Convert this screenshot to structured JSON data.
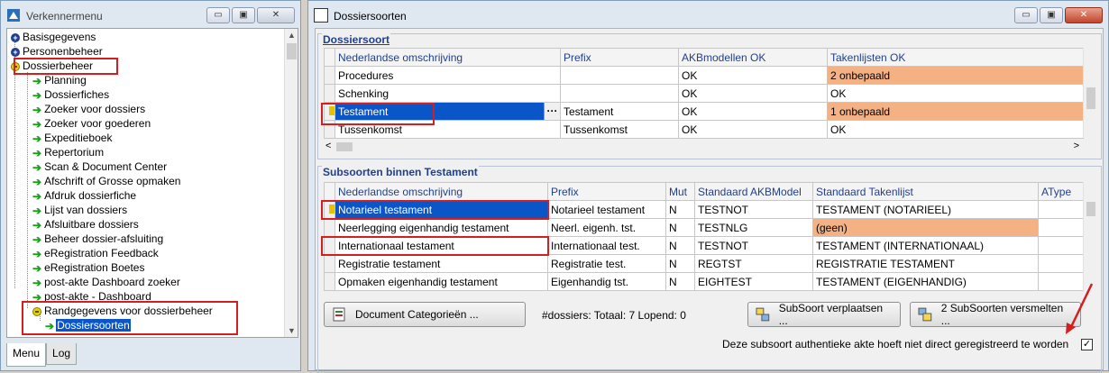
{
  "left_window": {
    "title": "Verkennermenu",
    "min": "▭",
    "max": "▣",
    "close": "✕",
    "tree": [
      {
        "label": "Basisgegevens",
        "type": "plus",
        "level": 0
      },
      {
        "label": "Personenbeheer",
        "type": "plus",
        "level": 0
      },
      {
        "label": "Dossierbeheer",
        "type": "minus",
        "level": 0
      },
      {
        "label": "Planning",
        "type": "leaf",
        "level": 1
      },
      {
        "label": "Dossierfiches",
        "type": "leaf",
        "level": 1
      },
      {
        "label": "Zoeker voor dossiers",
        "type": "leaf",
        "level": 1
      },
      {
        "label": "Zoeker voor goederen",
        "type": "leaf",
        "level": 1
      },
      {
        "label": "Expeditieboek",
        "type": "leaf",
        "level": 1
      },
      {
        "label": "Repertorium",
        "type": "leaf",
        "level": 1
      },
      {
        "label": "Scan & Document Center",
        "type": "leaf",
        "level": 1
      },
      {
        "label": "Afschrift of Grosse opmaken",
        "type": "leaf",
        "level": 1
      },
      {
        "label": "Afdruk dossierfiche",
        "type": "leaf",
        "level": 1
      },
      {
        "label": "Lijst van dossiers",
        "type": "leaf",
        "level": 1
      },
      {
        "label": "Afsluitbare dossiers",
        "type": "leaf",
        "level": 1
      },
      {
        "label": "Beheer dossier-afsluiting",
        "type": "leaf",
        "level": 1
      },
      {
        "label": "eRegistration Feedback",
        "type": "leaf",
        "level": 1
      },
      {
        "label": "eRegistration Boetes",
        "type": "leaf",
        "level": 1
      },
      {
        "label": "post-akte Dashboard zoeker",
        "type": "leaf",
        "level": 1
      },
      {
        "label": "post-akte - Dashboard",
        "type": "leaf",
        "level": 1
      },
      {
        "label": "Randgegevens voor dossierbeheer",
        "type": "minus",
        "level": 1
      },
      {
        "label": "Dossiersoorten",
        "type": "leaf",
        "level": 2,
        "selected": true
      }
    ],
    "tabs": [
      "Menu",
      "Log"
    ]
  },
  "right_window": {
    "title": "Dossiersoorten",
    "min": "▭",
    "max": "▣",
    "close": "✕",
    "dossiersoort": {
      "group_title": "Dossiersoort",
      "columns": [
        "Nederlandse omschrijving",
        "Prefix",
        "AKBmodellen OK",
        "Takenlijsten OK"
      ],
      "rows": [
        [
          "Procedures",
          "",
          "OK",
          "2 onbepaald"
        ],
        [
          "Schenking",
          "",
          "OK",
          "OK"
        ],
        [
          "Testament",
          "Testament",
          "OK",
          "1 onbepaald"
        ],
        [
          "Tussenkomst",
          "Tussenkomst",
          "OK",
          "OK"
        ]
      ],
      "ellipsis": "···"
    },
    "subsoorten": {
      "group_title": "Subsoorten binnen Testament",
      "columns": [
        "Nederlandse omschrijving",
        "Prefix",
        "Mut",
        "Standaard AKBModel",
        "Standaard Takenlijst",
        "AType"
      ],
      "rows": [
        [
          "Notarieel testament",
          "Notarieel testament",
          "N",
          "TESTNOT",
          "TESTAMENT (NOTARIEEL)",
          ""
        ],
        [
          "Neerlegging eigenhandig testament",
          "Neerl. eigenh. tst.",
          "N",
          "TESTNLG",
          "(geen)",
          ""
        ],
        [
          "Internationaal testament",
          "Internationaal test.",
          "N",
          "TESTNOT",
          "TESTAMENT (INTERNATIONAAL)",
          ""
        ],
        [
          "Registratie testament",
          "Registratie test.",
          "N",
          "REGTST",
          "REGISTRATIE TESTAMENT",
          ""
        ],
        [
          "Opmaken eigenhandig testament",
          "Eigenhandig tst.",
          "N",
          "EIGHTEST",
          "TESTAMENT (EIGENHANDIG)",
          ""
        ]
      ]
    },
    "buttons": {
      "doc_cat": "Document Categorieën ...",
      "verplaatsen": "SubSoort verplaatsen ...",
      "versmelten": "2 SubSoorten versmelten ..."
    },
    "status": "#dossiers:  Totaal: 7   Lopend: 0",
    "checkbox_label": "Deze subsoort authentieke akte hoeft niet direct geregistreerd te worden",
    "checkbox_checked": "✓",
    "colors": {
      "accent": "#0a56c8",
      "orange": "#f4b183",
      "annotation": "#d21f1f"
    }
  }
}
